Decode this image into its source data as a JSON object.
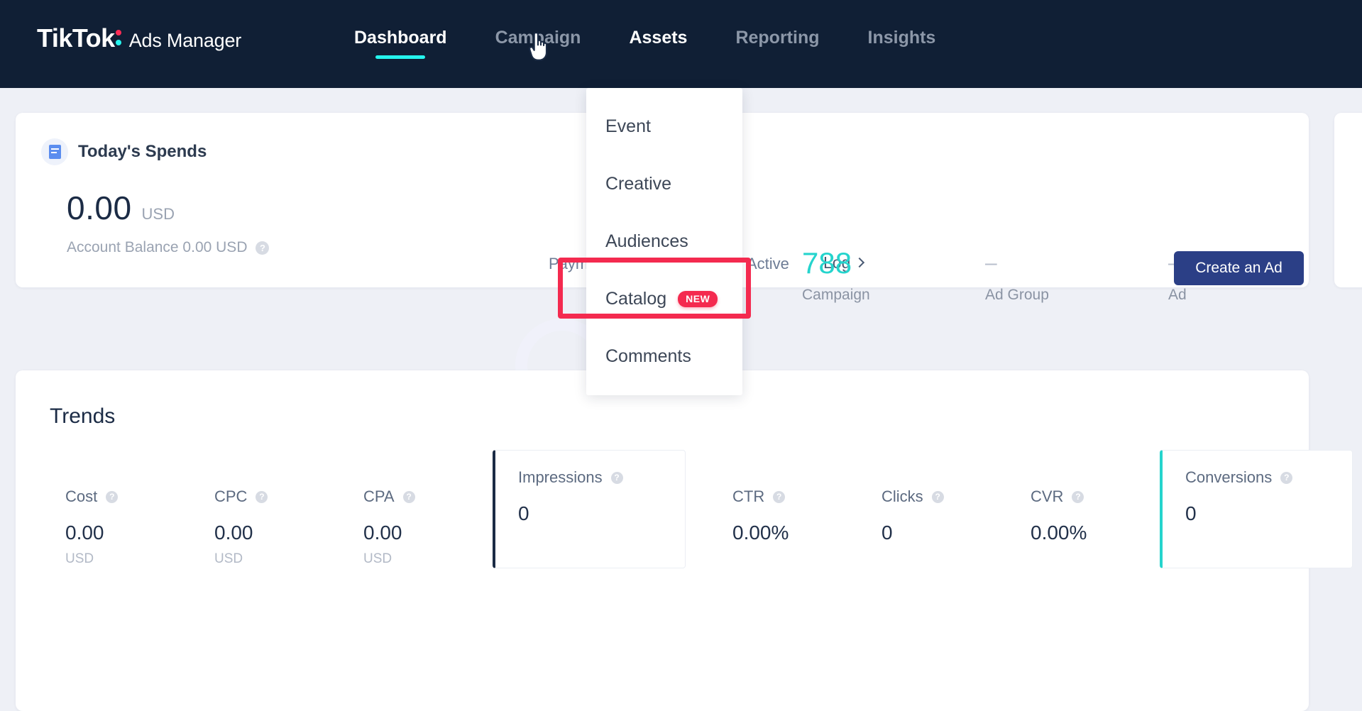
{
  "brand": {
    "logo_text": "TikTok",
    "subtitle": "Ads Manager",
    "colon_icon": "tiktok-colon-icon"
  },
  "nav": {
    "items": [
      {
        "label": "Dashboard",
        "state": "active"
      },
      {
        "label": "Campaign",
        "state": "default"
      },
      {
        "label": "Assets",
        "state": "hovered"
      },
      {
        "label": "Reporting",
        "state": "default"
      },
      {
        "label": "Insights",
        "state": "default"
      }
    ],
    "active_underline_color": "#25f4ee"
  },
  "assets_dropdown": {
    "open": true,
    "items": [
      {
        "label": "Event",
        "badge": null
      },
      {
        "label": "Creative",
        "badge": null
      },
      {
        "label": "Audiences",
        "badge": null
      },
      {
        "label": "Catalog",
        "badge": "NEW"
      },
      {
        "label": "Comments",
        "badge": null
      }
    ],
    "highlighted_item": "Catalog",
    "highlight_color": "#f42a4f"
  },
  "spends_card": {
    "icon": "document-icon",
    "title": "Today's Spends",
    "amount": "0.00",
    "currency": "USD",
    "balance_text": "Account Balance 0.00 USD",
    "help_icon": "help-circle-icon",
    "payment_label": "Payment",
    "active_label": "Active",
    "log_label": "Log",
    "log_chevron_icon": "chevron-right-icon",
    "create_ad_label": "Create an Ad",
    "create_ad_color": "#2b3f86",
    "stats": [
      {
        "value": "788",
        "label": "Campaign",
        "is_dash": false
      },
      {
        "value": "–",
        "label": "Ad Group",
        "is_dash": true
      },
      {
        "value": "–",
        "label": "Ad",
        "is_dash": true
      }
    ],
    "stat_accent_color": "#25d4cd"
  },
  "trends_card": {
    "title": "Trends",
    "metrics": [
      {
        "name": "Cost",
        "value": "0.00",
        "unit": "USD",
        "boxed": false,
        "accent": null
      },
      {
        "name": "CPC",
        "value": "0.00",
        "unit": "USD",
        "boxed": false,
        "accent": null
      },
      {
        "name": "CPA",
        "value": "0.00",
        "unit": "USD",
        "boxed": false,
        "accent": null
      },
      {
        "name": "Impressions",
        "value": "0",
        "unit": "",
        "boxed": true,
        "accent": "#1b2b45"
      },
      {
        "name": "CTR",
        "value": "0.00%",
        "unit": "",
        "boxed": false,
        "accent": null
      },
      {
        "name": "Clicks",
        "value": "0",
        "unit": "",
        "boxed": false,
        "accent": null
      },
      {
        "name": "CVR",
        "value": "0.00%",
        "unit": "",
        "boxed": false,
        "accent": null
      },
      {
        "name": "Conversions",
        "value": "0",
        "unit": "",
        "boxed": true,
        "accent": "#25d4cd"
      }
    ],
    "help_icon": "help-circle-icon"
  },
  "cursor": {
    "icon": "pointing-hand-cursor"
  }
}
